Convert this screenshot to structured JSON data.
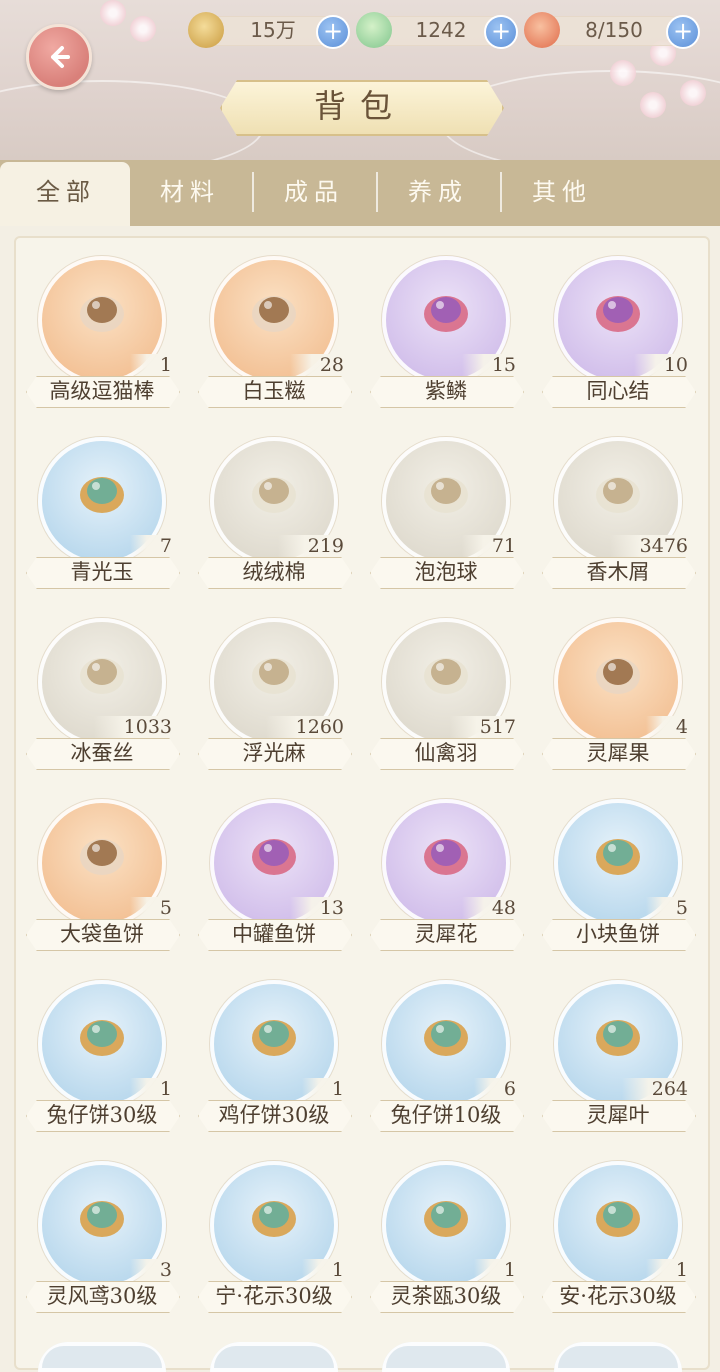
{
  "resources": [
    {
      "icon": "paw-coin-icon",
      "value": "15万"
    },
    {
      "icon": "jade-gourd-icon",
      "value": "1242"
    },
    {
      "icon": "stamina-bun-icon",
      "value": "8/150"
    }
  ],
  "title": "背包",
  "tabs": [
    "全部",
    "材料",
    "成品",
    "养成",
    "其他"
  ],
  "items": [
    {
      "name": "高级逗猫棒",
      "count": "1",
      "bg": "orange",
      "icon": "cat-teaser-wand-icon"
    },
    {
      "name": "白玉糍",
      "count": "28",
      "bg": "orange",
      "icon": "rice-cake-icon"
    },
    {
      "name": "紫鳞",
      "count": "15",
      "bg": "purple",
      "icon": "purple-scale-icon"
    },
    {
      "name": "同心结",
      "count": "10",
      "bg": "purple",
      "icon": "knot-charm-icon"
    },
    {
      "name": "青光玉",
      "count": "7",
      "bg": "blue",
      "icon": "jade-fish-icon"
    },
    {
      "name": "绒绒棉",
      "count": "219",
      "bg": "grey",
      "icon": "cotton-icon"
    },
    {
      "name": "泡泡球",
      "count": "71",
      "bg": "grey",
      "icon": "bubble-icon"
    },
    {
      "name": "香木屑",
      "count": "3476",
      "bg": "grey",
      "icon": "wood-log-icon"
    },
    {
      "name": "冰蚕丝",
      "count": "1033",
      "bg": "grey",
      "icon": "silk-cloth-icon"
    },
    {
      "name": "浮光麻",
      "count": "1260",
      "bg": "grey",
      "icon": "golden-flower-icon"
    },
    {
      "name": "仙禽羽",
      "count": "517",
      "bg": "grey",
      "icon": "feather-icon"
    },
    {
      "name": "灵犀果",
      "count": "4",
      "bg": "orange",
      "icon": "golden-fruit-branch-icon"
    },
    {
      "name": "大袋鱼饼",
      "count": "5",
      "bg": "orange",
      "icon": "fish-snack-bag-icon"
    },
    {
      "name": "中罐鱼饼",
      "count": "13",
      "bg": "purple",
      "icon": "fish-snack-can-icon"
    },
    {
      "name": "灵犀花",
      "count": "48",
      "bg": "purple",
      "icon": "golden-lotus-icon"
    },
    {
      "name": "小块鱼饼",
      "count": "5",
      "bg": "blue",
      "icon": "fish-cookie-icon"
    },
    {
      "name": "兔仔饼30级",
      "count": "1",
      "bg": "blue",
      "icon": "bunny-cookie-icon"
    },
    {
      "name": "鸡仔饼30级",
      "count": "1",
      "bg": "blue",
      "icon": "chick-cookie-icon"
    },
    {
      "name": "兔仔饼10级",
      "count": "6",
      "bg": "blue",
      "icon": "bunny-cookie-icon"
    },
    {
      "name": "灵犀叶",
      "count": "264",
      "bg": "blue",
      "icon": "golden-leaf-icon"
    },
    {
      "name": "灵风鸢30级",
      "count": "3",
      "bg": "blue",
      "icon": "kite-icon"
    },
    {
      "name": "宁·花示30级",
      "count": "1",
      "bg": "blue",
      "icon": "silver-bud-icon"
    },
    {
      "name": "灵茶瓯30级",
      "count": "1",
      "bg": "blue",
      "icon": "tea-bowl-icon"
    },
    {
      "name": "安·花示30级",
      "count": "1",
      "bg": "blue",
      "icon": "golden-bud-icon"
    }
  ]
}
